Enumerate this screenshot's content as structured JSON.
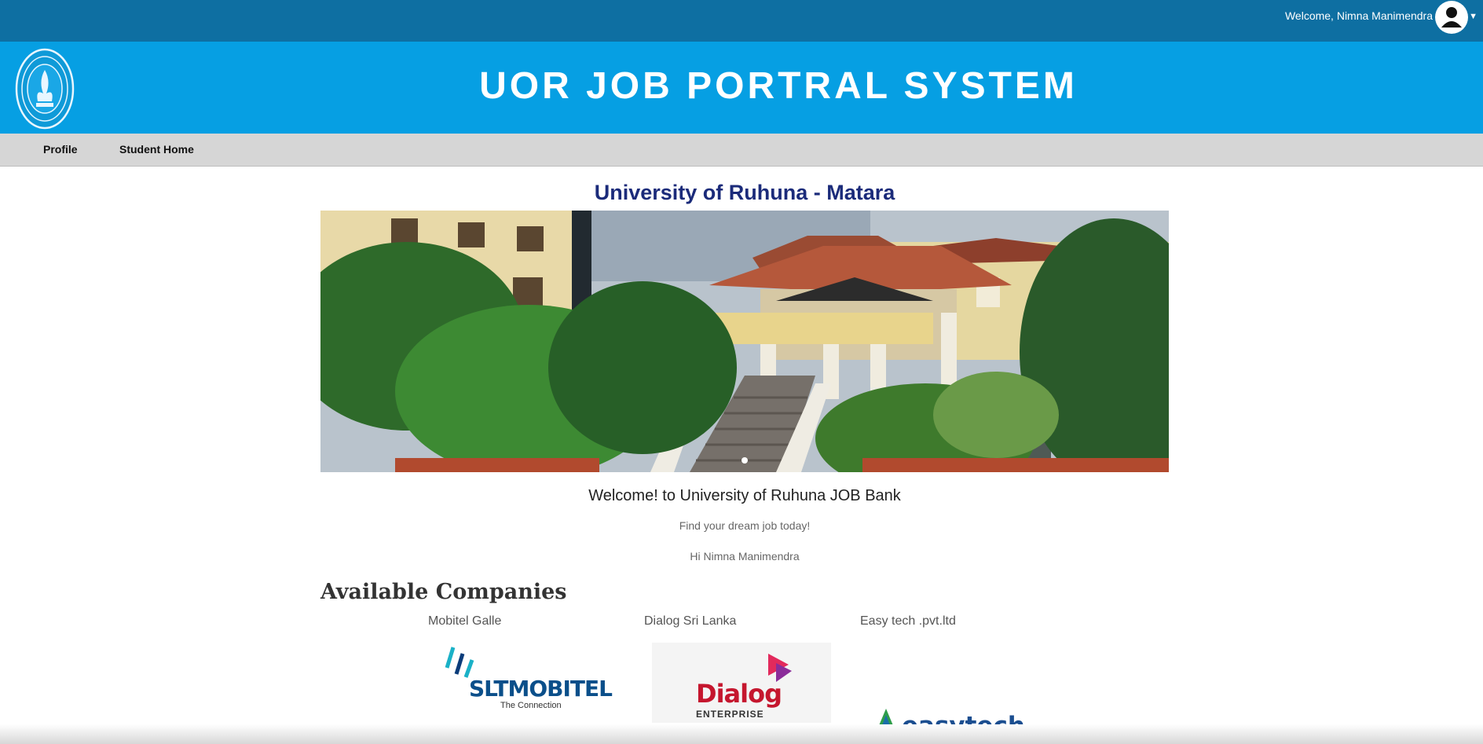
{
  "header": {
    "welcome_text": "Welcome, Nimna Manimendra",
    "user_icon": "user-avatar-icon",
    "dropdown_icon": "caret-down-icon"
  },
  "banner": {
    "title": "UOR JOB PORTRAL SYSTEM",
    "logo_icon": "university-crest-logo"
  },
  "nav": {
    "items": [
      {
        "label": "Profile"
      },
      {
        "label": "Student Home"
      }
    ]
  },
  "main": {
    "campus_title": "University of Ruhuna - Matara",
    "welcome_heading": "Welcome! to University of Ruhuna JOB Bank",
    "tagline": "Find your dream job today!",
    "greeting": "Hi Nimna Manimendra",
    "companies_heading": "Available Companies"
  },
  "companies": [
    {
      "name": "Mobitel Galle",
      "logo_text": "SLTMOBITEL",
      "logo_sub": "The Connection"
    },
    {
      "name": "Dialog Sri Lanka",
      "logo_text": "Dialog",
      "logo_sub": "ENTERPRISE"
    },
    {
      "name": "Easy tech .pvt.ltd",
      "logo_text": "easytech"
    }
  ],
  "colors": {
    "topbar": "#0e6fa2",
    "banner": "#069fe3",
    "navbar": "#d6d6d6",
    "campus_title": "#1b2b7a"
  }
}
